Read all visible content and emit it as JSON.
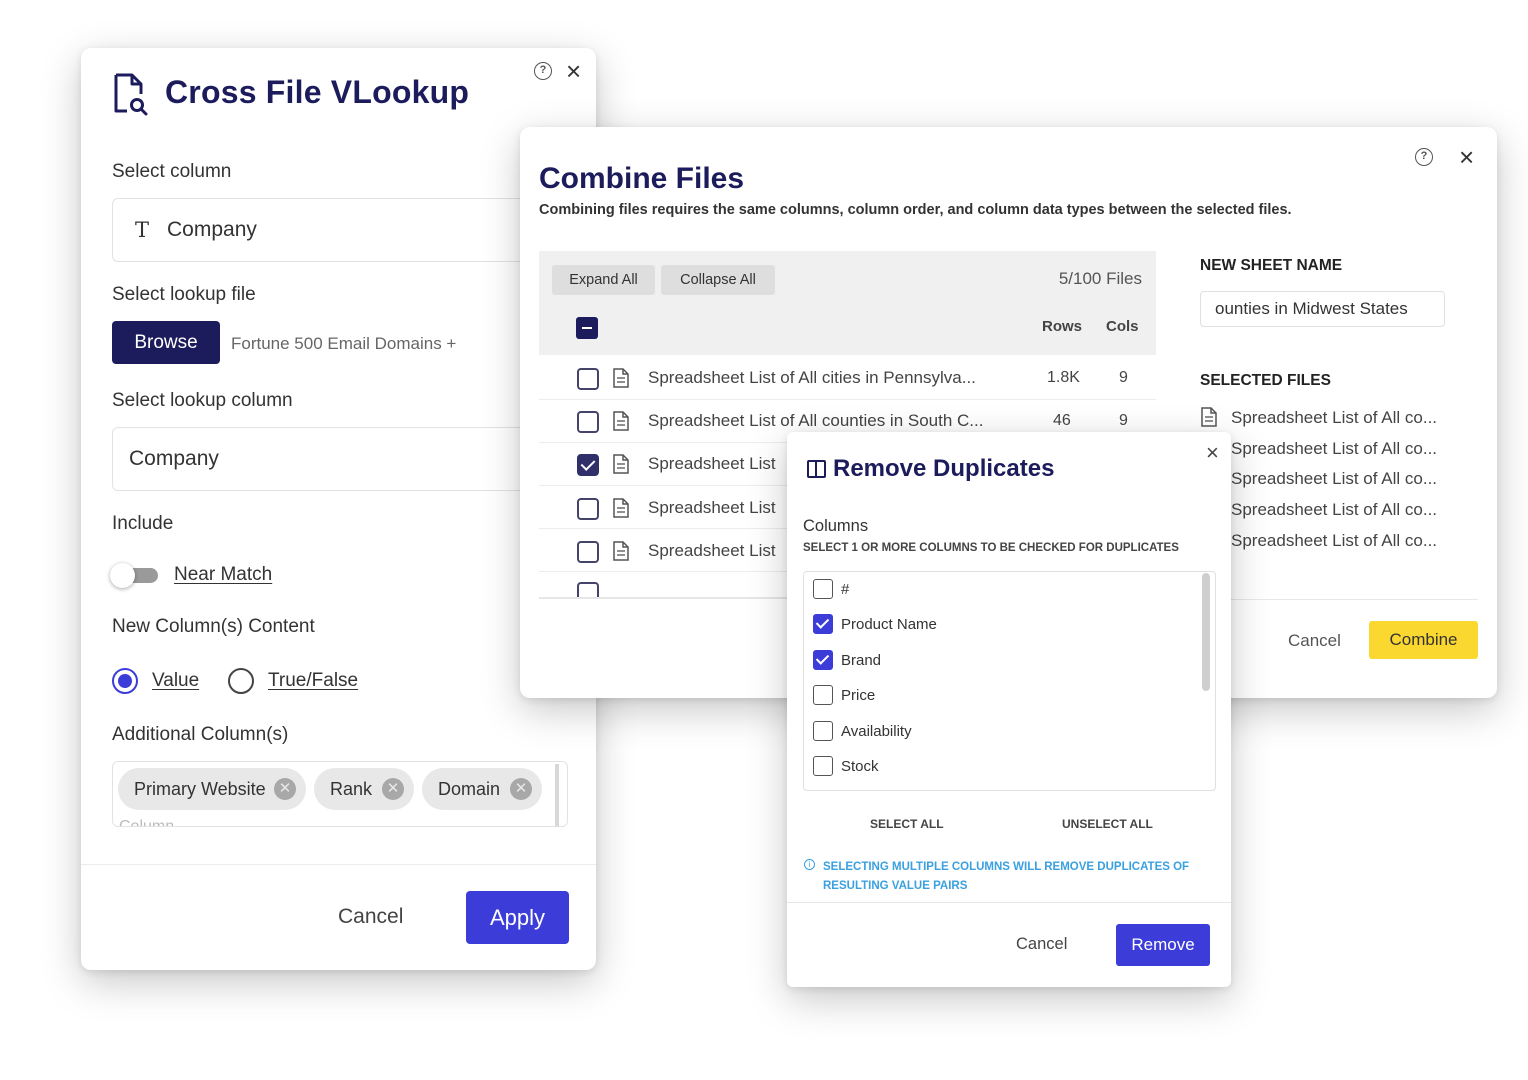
{
  "vlookup": {
    "title": "Cross File VLookup",
    "help_icon": "?",
    "close_icon": "×",
    "select_column_label": "Select column",
    "select_column_value": "Company",
    "text_type_icon": "T",
    "lookup_file_label": "Select lookup file",
    "browse_label": "Browse",
    "lookup_file_name": "Fortune 500 Email Domains +",
    "lookup_column_label": "Select lookup column",
    "lookup_column_value": "Company",
    "include_label": "Include",
    "near_match_label": "Near Match",
    "near_match_on": false,
    "new_content_label": "New Column(s) Content",
    "options": [
      "Value",
      "True/False"
    ],
    "selected_option": "Value",
    "additional_label": "Additional Column(s)",
    "chips": [
      "Primary Website",
      "Rank",
      "Domain"
    ],
    "column_placeholder": "Column",
    "cancel_label": "Cancel",
    "apply_label": "Apply",
    "accent_color": "#3c3cd8",
    "brand_color": "#1c1c5c"
  },
  "combine": {
    "title": "Combine Files",
    "subtitle": "Combining files requires the same columns, column order, and column data types between the selected files.",
    "expand_all": "Expand All",
    "collapse_all": "Collapse All",
    "files_count": "5/100 Files",
    "rows_header": "Rows",
    "cols_header": "Cols",
    "files": [
      {
        "name": "Spreadsheet List of All cities in Pennsylva...",
        "rows": "1.8K",
        "cols": "9",
        "checked": false
      },
      {
        "name": "Spreadsheet List of All counties in South C...",
        "rows": "46",
        "cols": "9",
        "checked": false
      },
      {
        "name": "Spreadsheet List",
        "rows": "",
        "cols": "",
        "checked": true
      },
      {
        "name": "Spreadsheet List",
        "rows": "",
        "cols": "",
        "checked": false
      },
      {
        "name": "Spreadsheet List",
        "rows": "",
        "cols": "",
        "checked": false
      }
    ],
    "new_sheet_label": "NEW SHEET NAME",
    "new_sheet_value": "ounties in Midwest States",
    "selected_files_label": "SELECTED FILES",
    "selected_files": [
      "Spreadsheet List of All co...",
      "Spreadsheet List of All co...",
      "Spreadsheet List of All co...",
      "Spreadsheet List of All co...",
      "Spreadsheet List of All co..."
    ],
    "cancel_label": "Cancel",
    "combine_label": "Combine",
    "combine_color": "#fbd830"
  },
  "dedupe": {
    "title": "Remove Duplicates",
    "close_icon": "×",
    "columns_label": "Columns",
    "columns_hint": "SELECT 1 OR MORE COLUMNS TO BE CHECKED FOR DUPLICATES",
    "columns": [
      {
        "name": "#",
        "checked": false
      },
      {
        "name": "Product Name",
        "checked": true
      },
      {
        "name": "Brand",
        "checked": true
      },
      {
        "name": "Price",
        "checked": false
      },
      {
        "name": "Availability",
        "checked": false
      },
      {
        "name": "Stock",
        "checked": false
      }
    ],
    "select_all": "SELECT ALL",
    "unselect_all": "UNSELECT ALL",
    "info_icon": "i",
    "note": "SELECTING MULTIPLE COLUMNS WILL REMOVE DUPLICATES OF RESULTING VALUE PAIRS",
    "cancel_label": "Cancel",
    "remove_label": "Remove"
  }
}
